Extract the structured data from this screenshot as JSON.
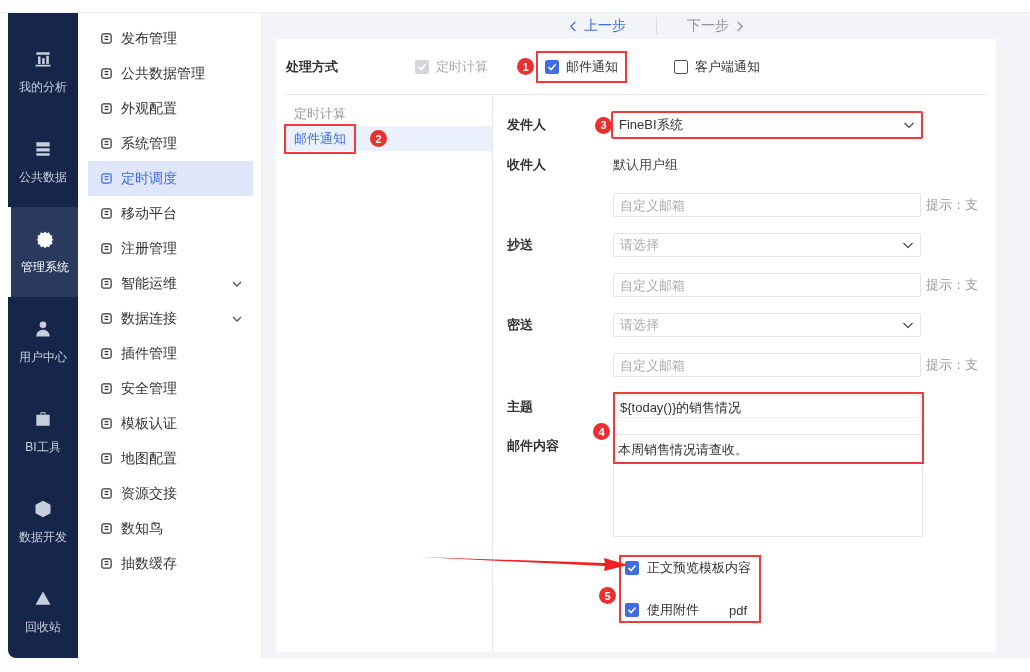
{
  "nav": [
    {
      "label": "我的分析",
      "selected": false
    },
    {
      "label": "公共数据",
      "selected": false
    },
    {
      "label": "管理系统",
      "selected": true
    },
    {
      "label": "用户中心",
      "selected": false
    },
    {
      "label": "BI工具",
      "selected": false
    },
    {
      "label": "数据开发",
      "selected": false
    },
    {
      "label": "回收站",
      "selected": false
    }
  ],
  "menu": [
    {
      "label": "发布管理",
      "selected": false,
      "expandable": false
    },
    {
      "label": "公共数据管理",
      "selected": false,
      "expandable": false
    },
    {
      "label": "外观配置",
      "selected": false,
      "expandable": false
    },
    {
      "label": "系统管理",
      "selected": false,
      "expandable": false
    },
    {
      "label": "定时调度",
      "selected": true,
      "expandable": false
    },
    {
      "label": "移动平台",
      "selected": false,
      "expandable": false
    },
    {
      "label": "注册管理",
      "selected": false,
      "expandable": false
    },
    {
      "label": "智能运维",
      "selected": false,
      "expandable": true
    },
    {
      "label": "数据连接",
      "selected": false,
      "expandable": true
    },
    {
      "label": "插件管理",
      "selected": false,
      "expandable": false
    },
    {
      "label": "安全管理",
      "selected": false,
      "expandable": false
    },
    {
      "label": "模板认证",
      "selected": false,
      "expandable": false
    },
    {
      "label": "地图配置",
      "selected": false,
      "expandable": false
    },
    {
      "label": "资源交接",
      "selected": false,
      "expandable": false
    },
    {
      "label": "数知鸟",
      "selected": false,
      "expandable": false
    },
    {
      "label": "抽数缓存",
      "selected": false,
      "expandable": false
    }
  ],
  "steps": [
    {
      "label": "上一步",
      "disabled": false
    },
    {
      "label": "下一步",
      "disabled": true
    }
  ],
  "process": {
    "label": "处理方式",
    "options": [
      {
        "label": "定时计算",
        "checked": true,
        "disabled": true
      },
      {
        "label": "邮件通知",
        "checked": true,
        "disabled": false,
        "badge": "1"
      },
      {
        "label": "客户端通知",
        "checked": false,
        "disabled": false
      }
    ]
  },
  "side_list": [
    {
      "label": "定时计算",
      "selected": false
    },
    {
      "label": "邮件通知",
      "selected": true,
      "badge": "2"
    }
  ],
  "rows": [
    {
      "kind": "select",
      "label": "发件人",
      "value": "FineBI系统",
      "badge": "3"
    },
    {
      "kind": "text",
      "label": "收件人",
      "value": "默认用户组"
    },
    {
      "kind": "input",
      "placeholder": "自定义邮箱",
      "hint": "提示：支"
    },
    {
      "kind": "select",
      "label": "抄送",
      "placeholder": "请选择"
    },
    {
      "kind": "input",
      "placeholder": "自定义邮箱",
      "hint": "提示：支"
    },
    {
      "kind": "select",
      "label": "密送",
      "placeholder": "请选择"
    },
    {
      "kind": "input",
      "placeholder": "自定义邮箱",
      "hint": "提示：支"
    }
  ],
  "message": {
    "badge": "4",
    "subject_label": "主题",
    "subject": "${today()}的销售情况",
    "content_label": "邮件内容",
    "content": "本周销售情况请查收。"
  },
  "options": {
    "badge": "5",
    "items": [
      {
        "label": "正文预览模板内容",
        "checked": true
      },
      {
        "label": "使用附件",
        "checked": true,
        "format": "pdf"
      }
    ]
  }
}
